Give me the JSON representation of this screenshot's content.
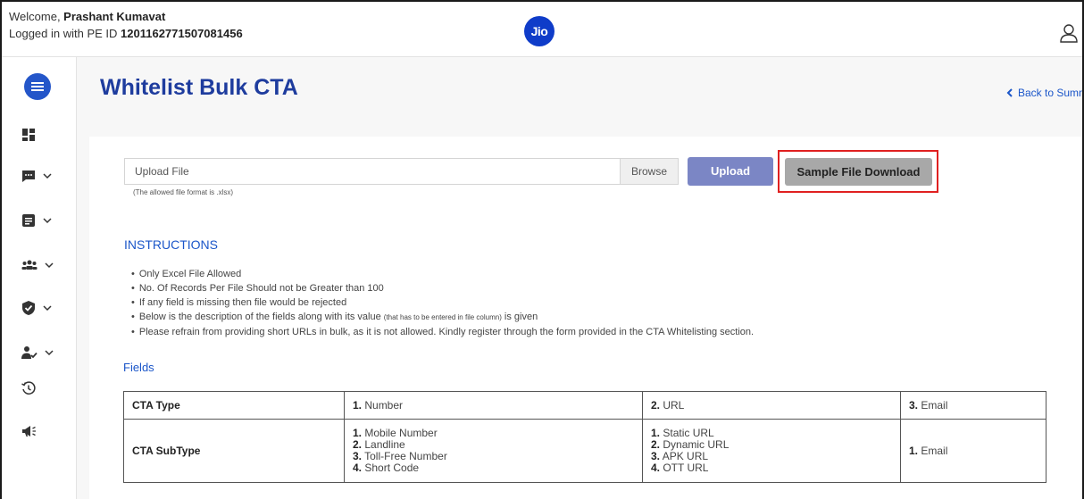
{
  "header": {
    "welcome_prefix": "Welcome, ",
    "user_name": "Prashant Kumavat",
    "pe_prefix": "Logged in with PE ID ",
    "pe_id": "1201162771507081456",
    "logo_text": "Jio"
  },
  "sidebar": {
    "items": [
      {
        "icon": "dashboard-icon"
      },
      {
        "icon": "message-icon"
      },
      {
        "icon": "document-icon"
      },
      {
        "icon": "group-icon"
      },
      {
        "icon": "shield-check-icon"
      },
      {
        "icon": "user-check-icon"
      },
      {
        "icon": "history-icon"
      },
      {
        "icon": "megaphone-icon"
      }
    ]
  },
  "page": {
    "title": "Whitelist Bulk CTA",
    "back_label": "Back to Summary"
  },
  "upload": {
    "file_placeholder": "Upload File",
    "browse_label": "Browse",
    "allowed_note": "(The allowed file format is .xlsx)",
    "upload_label": "Upload",
    "sample_label": "Sample File Download"
  },
  "instructions": {
    "title": "INSTRUCTIONS",
    "items": [
      "Only Excel File Allowed",
      "No. Of Records Per File Should not be Greater than 100",
      "If any field is missing then file would be rejected"
    ],
    "item4_a": "Below is the description of the fields along with its value ",
    "item4_note": "(that has to be entered in file column)",
    "item4_b": " is given",
    "item5": "Please refrain from providing short URLs in bulk, as it is not allowed. Kindly register through the form provided in the CTA Whitelisting section."
  },
  "fields": {
    "title": "Fields",
    "rows": [
      {
        "label": "CTA Type",
        "cols": [
          [
            {
              "n": "1.",
              "t": " Number"
            }
          ],
          [
            {
              "n": "2.",
              "t": " URL"
            }
          ],
          [
            {
              "n": "3.",
              "t": " Email"
            }
          ]
        ]
      },
      {
        "label": "CTA SubType",
        "cols": [
          [
            {
              "n": "1.",
              "t": " Mobile Number"
            },
            {
              "n": "2.",
              "t": " Landline"
            },
            {
              "n": "3.",
              "t": " Toll-Free Number"
            },
            {
              "n": "4.",
              "t": " Short Code"
            }
          ],
          [
            {
              "n": "1.",
              "t": " Static URL"
            },
            {
              "n": "2.",
              "t": " Dynamic URL"
            },
            {
              "n": "3.",
              "t": " APK URL"
            },
            {
              "n": "4.",
              "t": " OTT URL"
            }
          ],
          [
            {
              "n": "1.",
              "t": " Email"
            }
          ]
        ]
      }
    ]
  },
  "colors": {
    "brand_blue": "#0f3cc9",
    "title_blue": "#1e3c9e",
    "link_blue": "#1b56c9",
    "upload_button": "#7b86c5",
    "sample_button": "#a8a8a8",
    "highlight_red": "#e02020"
  }
}
